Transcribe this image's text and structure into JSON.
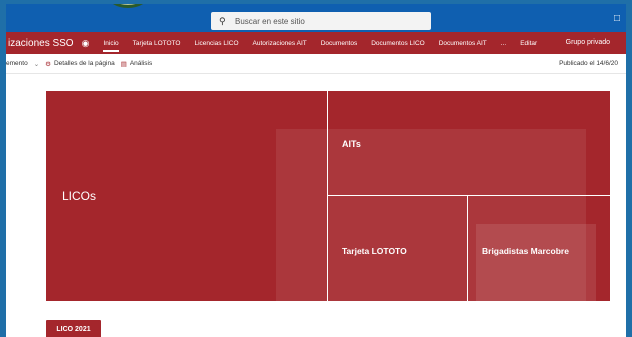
{
  "topbar": {
    "search_placeholder": "Buscar en este sitio",
    "share_icon": "share-icon"
  },
  "navbar": {
    "site_title": "izaciones SSO",
    "items": [
      {
        "label": "Inicio",
        "active": true
      },
      {
        "label": "Tarjeta LOTOTO"
      },
      {
        "label": "Licencias LICO"
      },
      {
        "label": "Autorizaciones AIT"
      },
      {
        "label": "Documentos"
      },
      {
        "label": "Documentos LICO"
      },
      {
        "label": "Documentos AIT"
      },
      {
        "label": "..."
      },
      {
        "label": "Editar"
      }
    ],
    "group_label": "Grupo privado"
  },
  "toolbar": {
    "partial_item": "emento",
    "page_details": "Detalles de la página",
    "analysis": "Análisis",
    "published": "Publicado el 14/6/20"
  },
  "tiles": {
    "licos": "LICOs",
    "aits": "AITs",
    "lototo": "Tarjeta LOTOTO",
    "brigadistas": "Brigadistas Marcobre"
  },
  "lico_button": "LICO 2021",
  "colors": {
    "brand_red": "#a4262c",
    "top_blue": "#0f5fb0"
  }
}
